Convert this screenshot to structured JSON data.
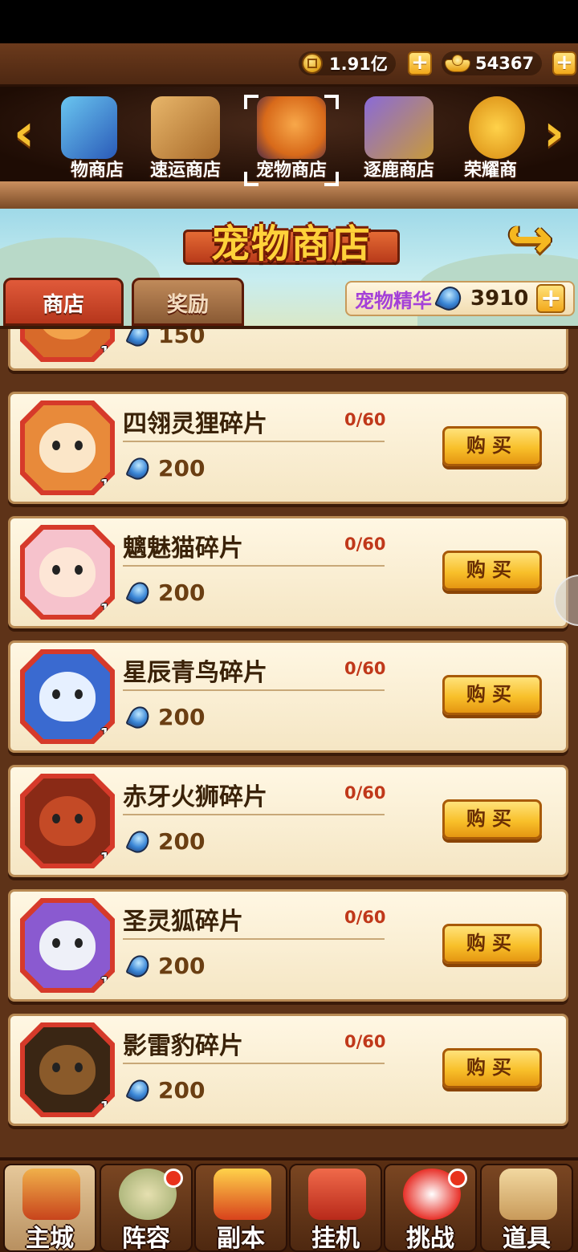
{
  "currency": {
    "coins": "1.91亿",
    "ingots": "54367",
    "coin_icon": "gold-coin-icon",
    "ingot_icon": "gold-ingot-icon"
  },
  "shop_tabs": [
    {
      "label": "物商店"
    },
    {
      "label": "速运商店"
    },
    {
      "label": "宠物商店",
      "selected": true
    },
    {
      "label": "逐鹿商店"
    },
    {
      "label": "荣耀商"
    }
  ],
  "banner": {
    "title": "宠物商店"
  },
  "subtabs": {
    "shop": "商店",
    "reward": "奖励"
  },
  "essence": {
    "label": "宠物精华",
    "value": "3910"
  },
  "partial_item": {
    "price": "150",
    "count": "1"
  },
  "items": [
    {
      "name": "四翎灵狸碎片",
      "progress": "0/60",
      "price": "200",
      "count": "1",
      "buy": "购买",
      "color": "#f2a24a"
    },
    {
      "name": "魑魅猫碎片",
      "progress": "0/60",
      "price": "200",
      "count": "1",
      "buy": "购买",
      "color": "#f6b8c4"
    },
    {
      "name": "星辰青鸟碎片",
      "progress": "0/60",
      "price": "200",
      "count": "1",
      "buy": "购买",
      "color": "#4a7ad8"
    },
    {
      "name": "赤牙火狮碎片",
      "progress": "0/60",
      "price": "200",
      "count": "1",
      "buy": "购买",
      "color": "#a83a22"
    },
    {
      "name": "圣灵狐碎片",
      "progress": "0/60",
      "price": "200",
      "count": "1",
      "buy": "购买",
      "color": "#9a6ad8"
    },
    {
      "name": "影雷豹碎片",
      "progress": "0/60",
      "price": "200",
      "count": "1",
      "buy": "购买",
      "color": "#5a3a20"
    }
  ],
  "bottom_nav": [
    {
      "label": "主城",
      "active": true
    },
    {
      "label": "阵容",
      "badge": true
    },
    {
      "label": "副本"
    },
    {
      "label": "挂机"
    },
    {
      "label": "挑战",
      "badge": true
    },
    {
      "label": "道具"
    }
  ]
}
